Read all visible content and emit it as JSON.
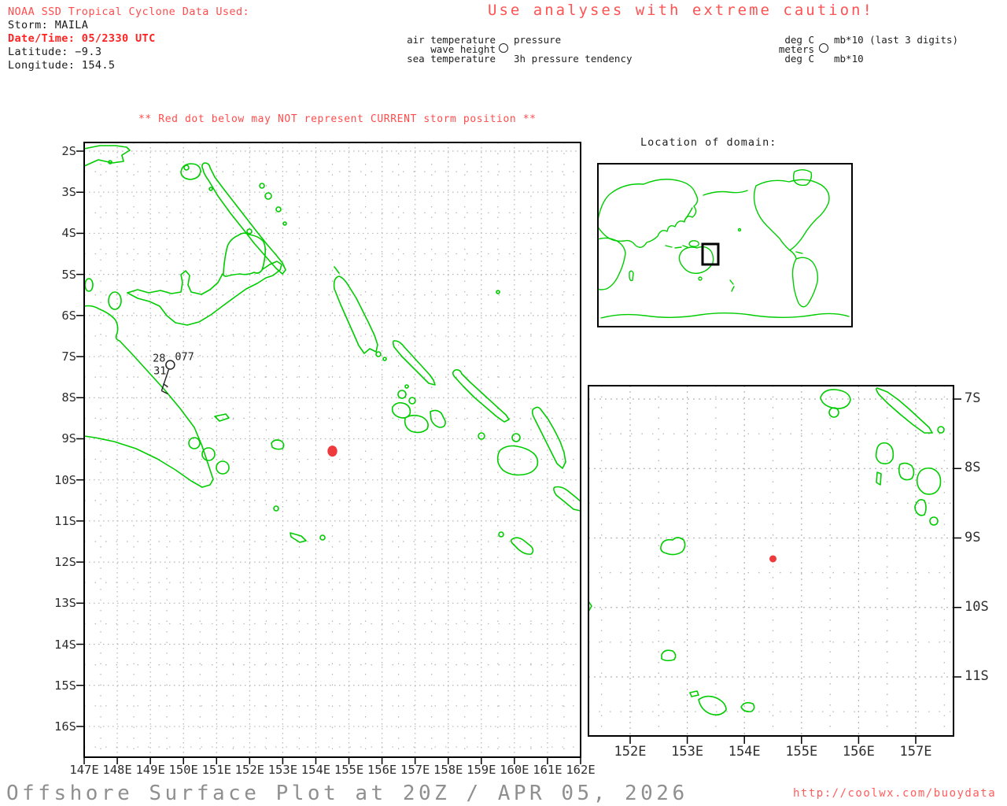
{
  "header": {
    "source_line": "NOAA SSD Tropical Cyclone Data Used:",
    "storm_line": "Storm: MAILA",
    "datetime_line": "Date/Time: 05/2330 UTC",
    "latitude_line": "Latitude: −9.3",
    "longitude_line": "Longitude: 154.5"
  },
  "caution_banner": "Use analyses with extreme caution!",
  "station_legend": {
    "row1_left": "air temperature",
    "row2_left": "wave height",
    "row3_left": "sea temperature",
    "row1_right": "pressure",
    "row3_right": "3h pressure tendency",
    "symbol": "station-circle"
  },
  "units_legend": {
    "row1_left": "deg C",
    "row2_left": "meters",
    "row3_left": "deg C",
    "row1_right": "mb*10 (last 3 digits)",
    "row3_right": "mb*10"
  },
  "warning_line": "** Red dot below may NOT represent CURRENT storm position **",
  "domain_map": {
    "label": "Location of domain:"
  },
  "main_map": {
    "lat_labels": [
      "2S",
      "3S",
      "4S",
      "5S",
      "6S",
      "7S",
      "8S",
      "9S",
      "10S",
      "11S",
      "12S",
      "13S",
      "14S",
      "15S",
      "16S"
    ],
    "lon_labels": [
      "147E",
      "148E",
      "149E",
      "150E",
      "151E",
      "152E",
      "153E",
      "154E",
      "155E",
      "156E",
      "157E",
      "158E",
      "159E",
      "160E",
      "161E",
      "162E"
    ],
    "storm_dot": {
      "lon_e": 154.5,
      "lat_s": 9.3
    },
    "station_ob": {
      "air_temperature": "28",
      "sea_temperature": "31",
      "pressure": "077",
      "lon_e": 149.6,
      "lat_s": 7.2
    }
  },
  "inset_map": {
    "lat_labels": [
      "7S",
      "8S",
      "9S",
      "10S",
      "11S"
    ],
    "lon_labels": [
      "152E",
      "153E",
      "154E",
      "155E",
      "156E",
      "157E"
    ],
    "storm_dot": {
      "lon_e": 154.5,
      "lat_s": 9.3
    }
  },
  "footer": {
    "title": "Offshore Surface Plot at 20Z / APR 05, 2026",
    "url": "http://coolwx.com/buoydata"
  },
  "colors": {
    "coastline": "#00cc00",
    "alert_red": "#ff4d4d",
    "storm_dot": "#ee3a3c",
    "grid_gray": "#b4b4b4",
    "title_gray": "#8f8f8f"
  }
}
